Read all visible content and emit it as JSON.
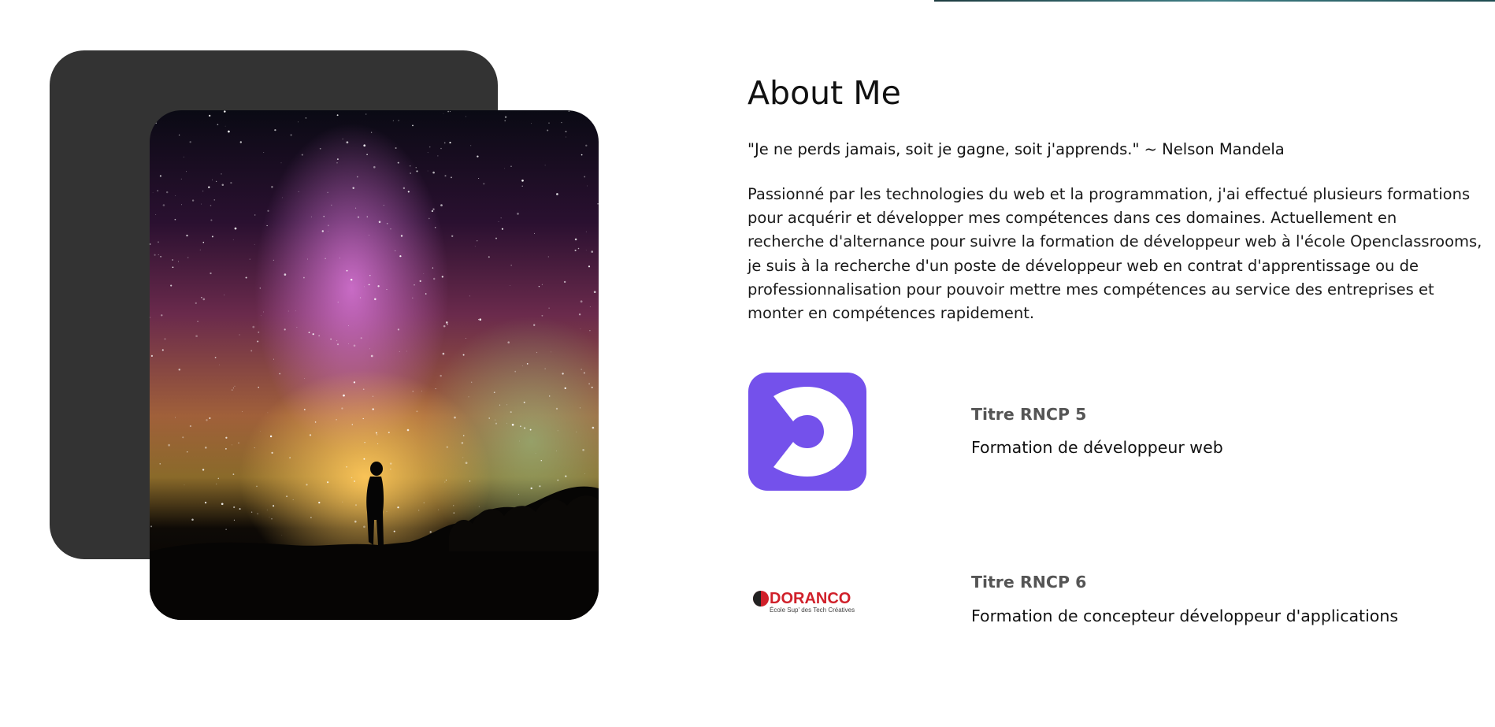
{
  "about": {
    "title": "About Me",
    "quote": "\"Je ne perds jamais, soit je gagne, soit j'apprends.\" ~ Nelson Mandela",
    "bio_lines": [
      "Passionné par les technologies du web et la programmation, j'ai effectué plusieurs formations",
      "pour acquérir et développer mes compétences dans ces domaines. Actuellement en",
      "recherche d'alternance pour suivre la formation de développeur web à l'école Openclassrooms,",
      "je suis à la recherche d'un poste de développeur web en contrat d'apprentissage ou de",
      "professionnalisation pour pouvoir mettre mes compétences au service des entreprises et",
      "monter en compétences rapidement."
    ]
  },
  "certifications": [
    {
      "logo": "openclassrooms-logo",
      "title": "Titre RNCP 5",
      "description": "Formation de développeur web"
    },
    {
      "logo": "doranco-logo",
      "title": "Titre RNCP 6",
      "description": "Formation de concepteur développeur d'applications",
      "logo_text_main": "DORANCO",
      "logo_text_sub": "École Sup' des Tech Créatives"
    }
  ],
  "colors": {
    "openclassrooms": "#7451eb",
    "doranco_red": "#d0202a",
    "back_card": "#333333",
    "cert_title": "#555555"
  }
}
